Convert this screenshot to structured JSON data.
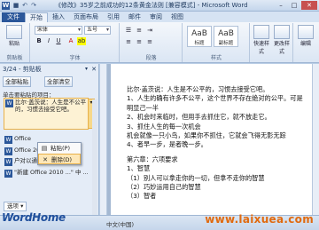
{
  "window": {
    "app_icon": "W",
    "title": "《修改》35岁之前成功的12条黄金法则 [兼容模式] - Microsoft Word",
    "minimize": "–",
    "maximize": "□",
    "close": "✕"
  },
  "qat": {
    "save": "■",
    "undo": "↶",
    "redo": "↷"
  },
  "tabs": [
    "文件",
    "开始",
    "插入",
    "页面布局",
    "引用",
    "邮件",
    "审阅",
    "视图"
  ],
  "ribbon": {
    "clipboard_group": "剪贴板",
    "paste_label": "粘贴",
    "font_name": "宋体",
    "font_size": "五号",
    "font_group": "字体",
    "paragraph_group": "段落",
    "styles": [
      {
        "sample": "AaB",
        "name": "标题"
      },
      {
        "sample": "AaB",
        "name": "副标题"
      }
    ],
    "styles_group": "样式",
    "quick_styles": "快速样式",
    "change_styles": "更改样式",
    "edit_label": "编辑"
  },
  "pane": {
    "header": "3/24 - 剪贴板",
    "paste_all": "全部粘贴",
    "clear_all": "全部清空",
    "hint": "单击要粘贴的项目：",
    "items": [
      "比尔·盖茨说：人生是不公平的，习惯去接受它吧。",
      "Office",
      "Office 2010",
      "户对以通过Office",
      "\"新建 Office 2010 ...\" 中 ..."
    ],
    "menu": [
      {
        "icon": "📋",
        "label": "粘贴(P)"
      },
      {
        "icon": "✕",
        "label": "删除(D)"
      }
    ],
    "options": "选项 ▾"
  },
  "document": {
    "lines": [
      "比尔·盖茨说：人生是不公平的，习惯去接受它吧。",
      "1、人生的确有许多不公平，这个世界不存在绝对的公平。可是",
      "明显己一半",
      "2、机会时来临时，但用手去抓住它，就不放走它。",
      "3、抓住人生的每一次机会",
      "机会就像一只小鸟，如果你不抓住，它就会飞得无影无踪",
      "4、者早一步，是者晚一步。",
      "第六章：六项要求",
      "1、智慧",
      "（1）别人可以拿走你的一切，但拿不走你的智慧",
      "（2）巧妙运用自己的智慧",
      "（3）智者"
    ]
  },
  "status": {
    "language": "中文(中国)"
  },
  "branding": {
    "left": "WordHome",
    "right": "www.laixuea.com"
  }
}
